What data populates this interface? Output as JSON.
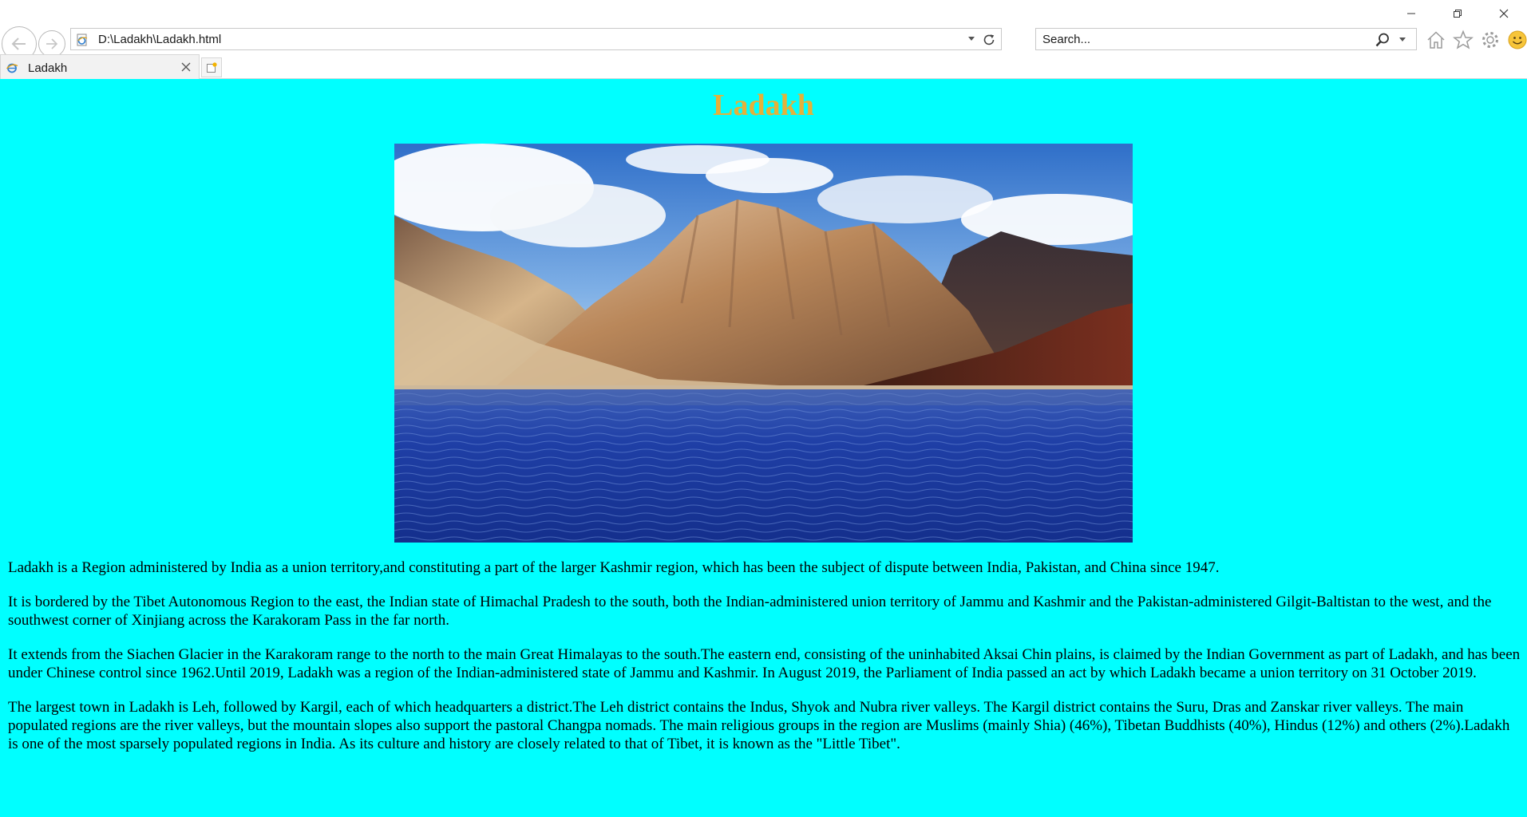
{
  "browser": {
    "address": "D:\\Ladakh\\Ladakh.html",
    "search_placeholder": "Search...",
    "tab_title": "Ladakh"
  },
  "page": {
    "title": "Ladakh",
    "title_color": "#e4b13a",
    "background_color": "#00ffff",
    "image_subject": "mountain-lake-photo",
    "paragraphs": [
      "Ladakh is a Region administered by India as a union territory,and constituting a part of the larger Kashmir region, which has been the subject of dispute between India, Pakistan, and China since 1947.",
      "It is bordered by the Tibet Autonomous Region to the east, the Indian state of Himachal Pradesh to the south, both the Indian-administered union territory of Jammu and Kashmir and the Pakistan-administered Gilgit-Baltistan to the west, and the southwest corner of Xinjiang across the Karakoram Pass in the far north.",
      "It extends from the Siachen Glacier in the Karakoram range to the north to the main Great Himalayas to the south.The eastern end, consisting of the uninhabited Aksai Chin plains, is claimed by the Indian Government as part of Ladakh, and has been under Chinese control since 1962.Until 2019, Ladakh was a region of the Indian-administered state of Jammu and Kashmir. In August 2019, the Parliament of India passed an act by which Ladakh became a union territory on 31 October 2019.",
      "The largest town in Ladakh is Leh, followed by Kargil, each of which headquarters a district.The Leh district contains the Indus, Shyok and Nubra river valleys. The Kargil district contains the Suru, Dras and Zanskar river valleys. The main populated regions are the river valleys, but the mountain slopes also support the pastoral Changpa nomads. The main religious groups in the region are Muslims (mainly Shia) (46%), Tibetan Buddhists (40%), Hindus (12%) and others (2%).Ladakh is one of the most sparsely populated regions in India. As its culture and history are closely related to that of Tibet, it is known as the \"Little Tibet\"."
    ]
  }
}
